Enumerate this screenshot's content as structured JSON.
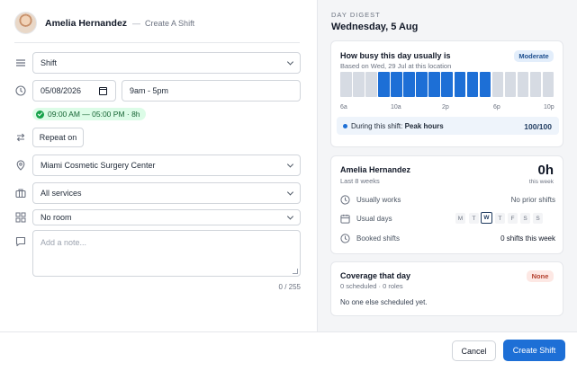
{
  "header": {
    "name": "Amelia Hernandez",
    "separator": "—",
    "subtitle": "Create A Shift"
  },
  "form": {
    "shift_type": "Shift",
    "date": "05/08/2026",
    "time": "9am - 5pm",
    "time_summary": "09:00 AM — 05:00 PM · 8h",
    "repeat_label": "Repeat on",
    "location": "Miami Cosmetic Surgery Center",
    "services": "All services",
    "room": "No room",
    "note_placeholder": "Add a note...",
    "note_counter": "0 / 255"
  },
  "digest": {
    "eyebrow": "DAY DIGEST",
    "date": "Wednesday, 5 Aug",
    "busy": {
      "title": "How busy this day usually is",
      "subtitle": "Based on Wed, 29 Jul at this location",
      "badge": "Moderate",
      "tick_labels": [
        "6a",
        "10a",
        "2p",
        "6p",
        "10p"
      ],
      "hour_activity": [
        0,
        0,
        0,
        1,
        1,
        1,
        1,
        1,
        1,
        1,
        1,
        1,
        0,
        0,
        0,
        0,
        0
      ],
      "peak_prefix": "During this shift:",
      "peak_label": "Peak hours",
      "peak_value": "100/100"
    },
    "staff": {
      "name": "Amelia Hernandez",
      "subtitle": "Last 8 weeks",
      "hours": "0h",
      "hours_caption": "this week",
      "usually_works_label": "Usually works",
      "usually_works_value": "No prior shifts",
      "usual_days_label": "Usual days",
      "days": [
        "M",
        "T",
        "W",
        "T",
        "F",
        "S",
        "S"
      ],
      "selected_day_index": 2,
      "booked_label": "Booked shifts",
      "booked_value": "0 shifts this week"
    },
    "coverage": {
      "title": "Coverage that day",
      "subtitle": "0 scheduled · 0 roles",
      "badge": "None",
      "empty_text": "No one else scheduled yet."
    }
  },
  "footer": {
    "cancel_label": "Cancel",
    "create_label": "Create Shift"
  },
  "colors": {
    "accent": "#1d6fd6",
    "bar_active": "#1d6fd6",
    "bar_inactive": "#d6dbe3",
    "success_bg": "#dcfce7",
    "badge_moderate_bg": "#e3eefb",
    "badge_none_bg": "#fde8e4"
  }
}
